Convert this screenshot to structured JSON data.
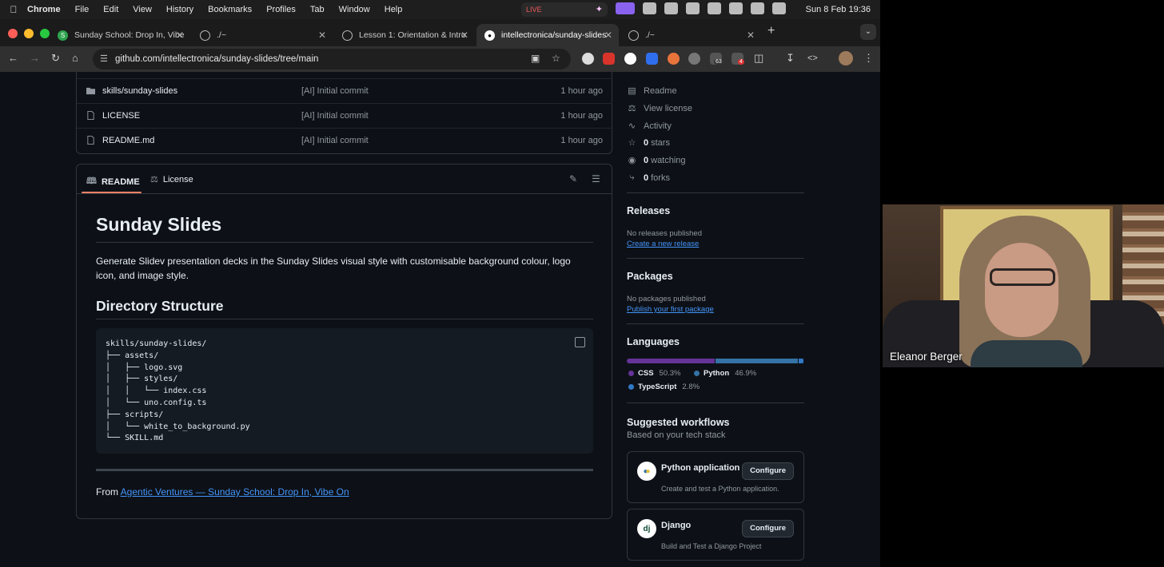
{
  "menubar": {
    "items": [
      "Chrome",
      "File",
      "Edit",
      "View",
      "History",
      "Bookmarks",
      "Profiles",
      "Tab",
      "Window",
      "Help"
    ],
    "live_label": "LIVE",
    "clock": "Sun 8 Feb  19:36"
  },
  "tabs": [
    {
      "title": "Sunday School: Drop In, Vibe",
      "icon": "sunday-school-favicon",
      "active": false
    },
    {
      "title": "./~",
      "icon": "history-icon",
      "active": false
    },
    {
      "title": "Lesson 1: Orientation & Intro",
      "icon": "globe-icon",
      "active": false
    },
    {
      "title": "intellectronica/sunday-slides",
      "icon": "github-icon",
      "active": true
    },
    {
      "title": "./~",
      "icon": "history-icon",
      "active": false
    }
  ],
  "toolbar": {
    "url": "github.com/intellectronica/sunday-slides/tree/main",
    "ext_badges": [
      "63",
      "4"
    ]
  },
  "files": [
    {
      "name": "skills/sunday-slides",
      "type": "folder",
      "message": "[AI] Initial commit",
      "date": "1 hour ago"
    },
    {
      "name": "LICENSE",
      "type": "file",
      "message": "[AI] Initial commit",
      "date": "1 hour ago"
    },
    {
      "name": "README.md",
      "type": "file",
      "message": "[AI] Initial commit",
      "date": "1 hour ago"
    }
  ],
  "readme": {
    "tab_readme": "README",
    "tab_license": "License",
    "title": "Sunday Slides",
    "intro": "Generate Slidev presentation decks in the Sunday Slides visual style with customisable background colour, logo icon, and image style.",
    "h2": "Directory Structure",
    "code": "skills/sunday-slides/\n├── assets/\n│   ├── logo.svg\n│   ├── styles/\n│   │   └── index.css\n│   └── uno.config.ts\n├── scripts/\n│   └── white_to_background.py\n└── SKILL.md",
    "from_prefix": "From ",
    "from_link": "Agentic Ventures — Sunday School: Drop In, Vibe On"
  },
  "sidebar": {
    "links": [
      {
        "icon": "book-icon",
        "label": "Readme",
        "count": ""
      },
      {
        "icon": "scale-icon",
        "label": "View license",
        "count": ""
      },
      {
        "icon": "pulse-icon",
        "label": "Activity",
        "count": ""
      },
      {
        "icon": "star-icon",
        "label": "stars",
        "count": "0"
      },
      {
        "icon": "eye-icon",
        "label": "watching",
        "count": "0"
      },
      {
        "icon": "fork-icon",
        "label": "forks",
        "count": "0"
      }
    ],
    "releases": {
      "title": "Releases",
      "sub": "No releases published",
      "link": "Create a new release"
    },
    "packages": {
      "title": "Packages",
      "sub": "No packages published",
      "link": "Publish your first package"
    },
    "languages": {
      "title": "Languages",
      "items": [
        {
          "name": "CSS",
          "percent": "50.3%",
          "value": 50.3,
          "color": "#663399"
        },
        {
          "name": "Python",
          "percent": "46.9%",
          "value": 46.9,
          "color": "#3572A5"
        },
        {
          "name": "TypeScript",
          "percent": "2.8%",
          "value": 2.8,
          "color": "#3178c6"
        }
      ]
    },
    "workflows": {
      "title": "Suggested workflows",
      "sub": "Based on your tech stack",
      "items": [
        {
          "name": "Python application",
          "desc": "Create and test a Python application.",
          "button": "Configure",
          "logo": "python-logo"
        },
        {
          "name": "Django",
          "desc": "Build and Test a Django Project",
          "button": "Configure",
          "logo": "dj"
        }
      ]
    }
  },
  "webcam": {
    "name": "Eleanor Berger"
  }
}
